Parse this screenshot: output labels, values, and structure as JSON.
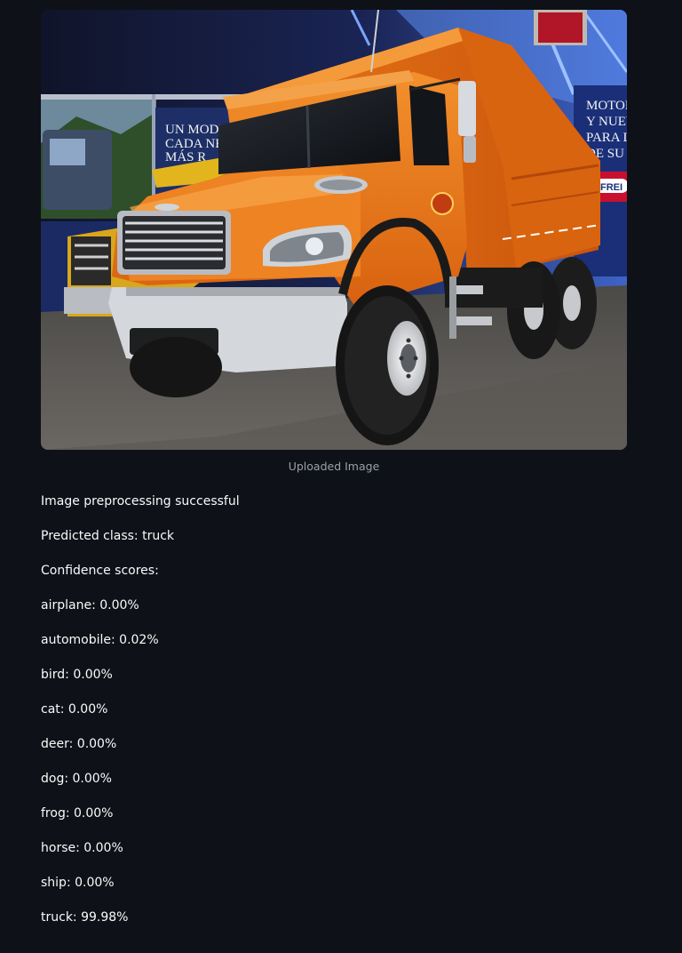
{
  "image": {
    "caption": "Uploaded Image",
    "signage_lines": [
      "UN MODEL",
      "CADA NE",
      "MÁS R",
      "MOTOR",
      "Y NUEV",
      "PARA L",
      "DE SU M",
      "FREI"
    ]
  },
  "status": {
    "preprocessing": "Image preprocessing successful",
    "predicted": "Predicted class: truck",
    "confidence_header": "Confidence scores:"
  },
  "scores": [
    "airplane: 0.00%",
    "automobile: 0.02%",
    "bird: 0.00%",
    "cat: 0.00%",
    "deer: 0.00%",
    "dog: 0.00%",
    "frog: 0.00%",
    "horse: 0.00%",
    "ship: 0.00%",
    "truck: 99.98%"
  ],
  "colors": {
    "background": "#0e1117",
    "text": "#fafafa",
    "caption": "#9aa0a8",
    "truck_orange": "#e8751a"
  }
}
